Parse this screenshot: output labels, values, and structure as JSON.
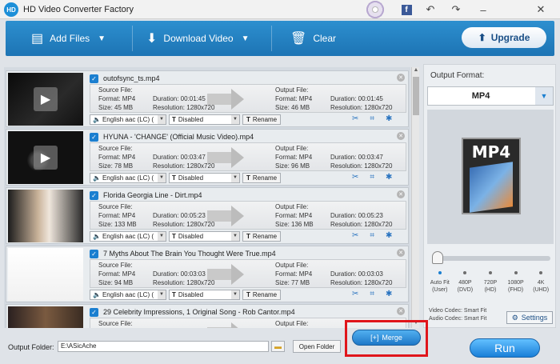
{
  "app": {
    "title": "HD Video Converter Factory",
    "logo_text": "HD"
  },
  "titlebar": {
    "icons": [
      "disc-icon",
      "facebook-icon",
      "undo-icon",
      "share-icon",
      "minimize-icon",
      "close-icon"
    ],
    "fb_label": "f"
  },
  "toolbar": {
    "add_files": "Add Files",
    "download_video": "Download Video",
    "clear": "Clear",
    "upgrade": "Upgrade"
  },
  "common": {
    "source_file": "Source File:",
    "output_file": "Output File:",
    "audio": "English aac (LC) (",
    "subtitle": "Disabled",
    "rename": "Rename"
  },
  "items": [
    {
      "name": "outofsync_ts.mp4",
      "src": {
        "format": "Format: MP4",
        "size": "Size: 45 MB",
        "duration": "Duration: 00:01:45",
        "resolution": "Resolution: 1280x720"
      },
      "out": {
        "format": "Format: MP4",
        "size": "Size: 46 MB",
        "duration": "Duration: 00:01:45",
        "resolution": "Resolution: 1280x720"
      }
    },
    {
      "name": "HYUNA - 'CHANGE' (Official Music Video).mp4",
      "src": {
        "format": "Format: MP4",
        "size": "Size: 78 MB",
        "duration": "Duration: 00:03:47",
        "resolution": "Resolution: 1280x720"
      },
      "out": {
        "format": "Format: MP4",
        "size": "Size: 96 MB",
        "duration": "Duration: 00:03:47",
        "resolution": "Resolution: 1280x720"
      }
    },
    {
      "name": "Florida Georgia Line - Dirt.mp4",
      "src": {
        "format": "Format: MP4",
        "size": "Size: 133 MB",
        "duration": "Duration: 00:05:23",
        "resolution": "Resolution: 1280x720"
      },
      "out": {
        "format": "Format: MP4",
        "size": "Size: 136 MB",
        "duration": "Duration: 00:05:23",
        "resolution": "Resolution: 1280x720"
      }
    },
    {
      "name": "7 Myths About The Brain You Thought Were True.mp4",
      "src": {
        "format": "Format: MP4",
        "size": "Size: 94 MB",
        "duration": "Duration: 00:03:03",
        "resolution": "Resolution: 1280x720"
      },
      "out": {
        "format": "Format: MP4",
        "size": "Size: 77 MB",
        "duration": "Duration: 00:03:03",
        "resolution": "Resolution: 1280x720"
      }
    },
    {
      "name": "29 Celebrity Impressions, 1 Original Song - Rob Cantor.mp4",
      "src": {
        "format": "",
        "size": "",
        "duration": "",
        "resolution": ""
      },
      "out": {
        "format": "",
        "size": "",
        "duration": "",
        "resolution": ""
      }
    }
  ],
  "right_panel": {
    "output_format_label": "Output Format:",
    "format": "MP4",
    "format_art_text": "MP4",
    "quality_levels": [
      {
        "l1": "Auto Fit",
        "l2": "(User)",
        "active": true
      },
      {
        "l1": "480P",
        "l2": "(DVD)"
      },
      {
        "l1": "720P",
        "l2": "(HD)"
      },
      {
        "l1": "1080P",
        "l2": "(FHD)"
      },
      {
        "l1": "4K",
        "l2": "(UHD)"
      }
    ],
    "video_codec": "Video Codec: Smart Fit",
    "audio_codec": "Audio Codec: Smart Fit",
    "settings": "Settings"
  },
  "bottom": {
    "output_folder_label": "Output Folder:",
    "output_folder_value": "E:\\ASicAche",
    "open_folder": "Open Folder",
    "merge": "Merge",
    "run": "Run"
  },
  "colors": {
    "accent": "#1d74b4",
    "highlight": "#e0151b"
  }
}
